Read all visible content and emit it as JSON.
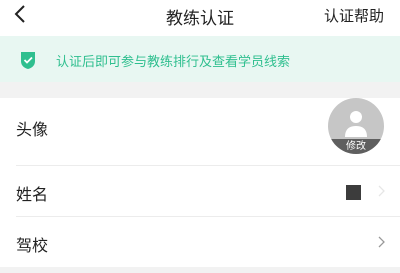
{
  "header": {
    "title": "教练认证",
    "help_label": "认证帮助"
  },
  "notice": {
    "text": "认证后即可参与教练排行及查看学员线索",
    "color": "#2fbf8f"
  },
  "rows": {
    "avatar_label": "头像",
    "avatar_edit_label": "修改",
    "name_label": "姓名",
    "school_label": "驾校"
  },
  "icons": {
    "back": "chevron-left-icon",
    "notice": "shield-check-icon",
    "avatar": "person-icon",
    "row_arrow": "chevron-right-icon"
  }
}
